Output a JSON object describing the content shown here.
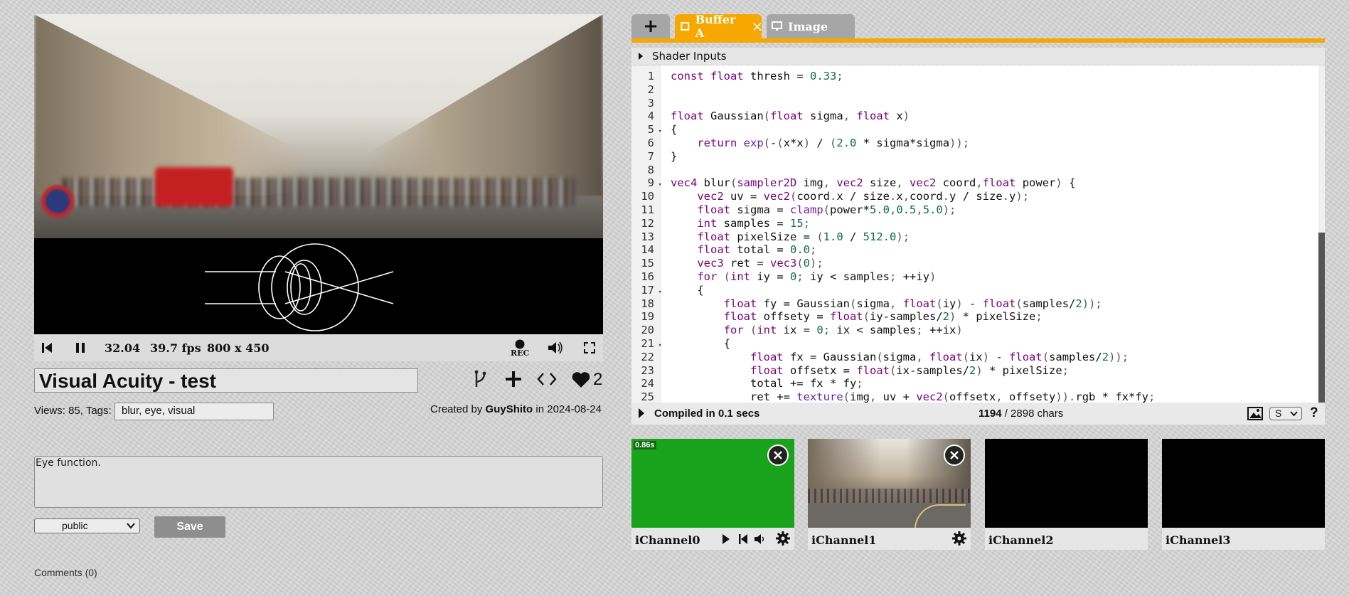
{
  "player": {
    "time": "32.04",
    "fps": "39.7 fps",
    "resolution": "800 x 450",
    "rec_label": "REC"
  },
  "shader": {
    "title": "Visual Acuity - test",
    "views_tags_label": "Views: 85, Tags:",
    "tags": "blur, eye, visual",
    "created_prefix": "Created by",
    "author": "GuyShito",
    "created_suffix": "in 2024-08-24",
    "likes": "2",
    "description": "Eye function.",
    "privacy": "public",
    "save_label": "Save",
    "comments": "Comments (0)"
  },
  "editor": {
    "tabs": [
      {
        "label": "+"
      },
      {
        "label": "Buffer A",
        "active": true
      },
      {
        "label": "Image"
      }
    ],
    "shader_inputs_label": "Shader Inputs",
    "compiled": "Compiled in 0.1 secs",
    "chars_count": "1194",
    "chars_total": "/ 2898 chars",
    "font_size_option": "S",
    "help": "?",
    "code_lines": [
      "const float thresh = 0.33;",
      "",
      "",
      "float Gaussian(float sigma, float x)",
      "{",
      "    return exp(-(x*x) / (2.0 * sigma*sigma));",
      "}",
      "",
      "vec4 blur(sampler2D img, vec2 size, vec2 coord,float power) {",
      "    vec2 uv = vec2(coord.x / size.x,coord.y / size.y);",
      "    float sigma = clamp(power*5.0,0.5,5.0);",
      "    int samples = 15;",
      "    float pixelSize = (1.0 / 512.0);",
      "    float total = 0.0;",
      "    vec3 ret = vec3(0);",
      "    for (int iy = 0; iy < samples; ++iy)",
      "    {",
      "        float fy = Gaussian(sigma, float(iy) - float(samples/2));",
      "        float offsety = float(iy-samples/2) * pixelSize;",
      "        for (int ix = 0; ix < samples; ++ix)",
      "        {",
      "            float fx = Gaussian(sigma, float(ix) - float(samples/2));",
      "            float offsetx = float(ix-samples/2) * pixelSize;",
      "            total += fx * fy;",
      "            ret += texture(img, uv + vec2(offsetx, offsety)).rgb * fx*fy;"
    ],
    "fold_lines": [
      5,
      9,
      17,
      21
    ]
  },
  "channels": [
    {
      "label": "iChannel0",
      "badge": "0.86s",
      "kind": "green",
      "color": "#19a31c"
    },
    {
      "label": "iChannel1",
      "kind": "image"
    },
    {
      "label": "iChannel2",
      "kind": "empty"
    },
    {
      "label": "iChannel3",
      "kind": "empty"
    }
  ],
  "colors": {
    "accent": "#f6a700",
    "tab_inactive": "#a6a6a6",
    "save_button": "#8e8e8e"
  }
}
